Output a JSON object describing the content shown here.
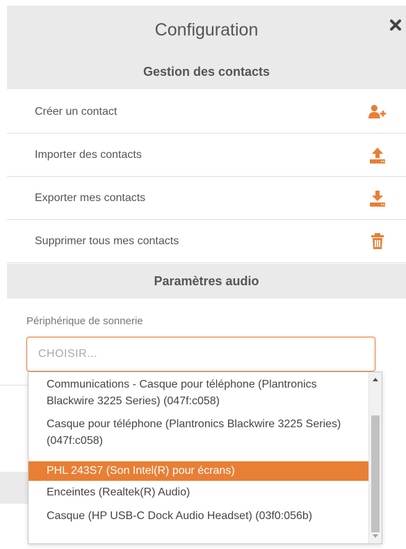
{
  "header": {
    "title": "Configuration",
    "close_icon": "close-icon"
  },
  "contacts": {
    "section_title": "Gestion des contacts",
    "items": [
      {
        "label": "Créer un contact",
        "icon": "add-user-icon"
      },
      {
        "label": "Importer des contacts",
        "icon": "upload-icon"
      },
      {
        "label": "Exporter mes contacts",
        "icon": "download-icon"
      },
      {
        "label": "Supprimer tous mes contacts",
        "icon": "trash-icon"
      }
    ]
  },
  "audio": {
    "section_title": "Paramètres audio",
    "ringtone_device_label": "Périphérique de sonnerie",
    "select_placeholder": "CHOISIR...",
    "options": [
      {
        "label": "Communications - Casque pour téléphone (Plantronics Blackwire 3225 Series) (047f:c058)",
        "selected": false
      },
      {
        "label": "Casque pour téléphone (Plantronics Blackwire 3225 Series) (047f:c058)",
        "selected": false
      },
      {
        "label": "PHL 243S7 (Son Intel(R) pour écrans)",
        "selected": true
      },
      {
        "label": "Enceintes (Realtek(R) Audio)",
        "selected": false
      },
      {
        "label": "Casque (HP USB-C Dock Audio Headset) (03f0:056b)",
        "selected": false
      }
    ]
  },
  "colors": {
    "accent": "#e87f35",
    "header_bg": "#eaeaea",
    "text": "#555555"
  }
}
